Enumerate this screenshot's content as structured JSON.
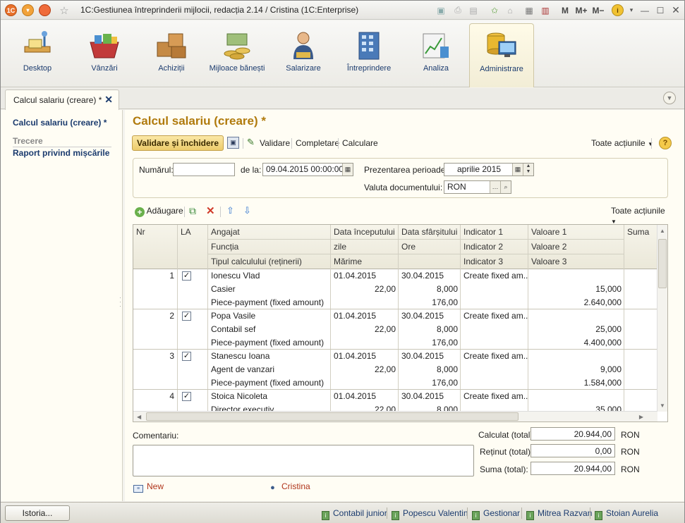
{
  "window": {
    "title": "1C:Gestiunea întreprinderii mijlocii, redacția 2.14 / Cristina  (1C:Enterprise)",
    "app_badge": "1C",
    "toolbar_right": [
      "M",
      "M+",
      "M−"
    ]
  },
  "sections": [
    {
      "label": "Desktop",
      "icon": "desk-icon"
    },
    {
      "label": "Vânzări",
      "icon": "basket-icon"
    },
    {
      "label": "Achiziții",
      "icon": "boxes-icon"
    },
    {
      "label": "Mijloace bănești",
      "icon": "coins-icon"
    },
    {
      "label": "Salarizare",
      "icon": "person-icon"
    },
    {
      "label": "Întreprindere",
      "icon": "building-icon"
    },
    {
      "label": "Analiza",
      "icon": "chart-icon"
    },
    {
      "label": "Administrare",
      "icon": "database-icon",
      "active": true
    }
  ],
  "tab": {
    "label": "Calcul salariu (creare) *"
  },
  "left_pane": {
    "current": "Calcul salariu (creare) *",
    "group": "Trecere",
    "link": "Raport privind mișcările"
  },
  "doc": {
    "title": "Calcul salariu (creare) *",
    "commands": {
      "validate_close": "Validare și închidere",
      "validate": "Validare",
      "fill": "Completare",
      "calculate": "Calculare",
      "all_actions": "Toate acțiunile"
    },
    "header": {
      "number_label": "Numărul:",
      "number_value": "",
      "date_label": "de la:",
      "date_value": "09.04.2015 00:00:00",
      "period_label": "Prezentarea perioadei:",
      "period_value": "aprilie 2015",
      "currency_label": "Valuta documentului:",
      "currency_value": "RON"
    },
    "table_bar": {
      "add": "Adăugare",
      "all_actions": "Toate acțiunile"
    },
    "columns": {
      "nr": "Nr",
      "la": "LA",
      "employee": "Angajat",
      "position": "Funcția",
      "calc_type": "Tipul calculului (reținerii)",
      "start": "Data începutului",
      "days": "zile",
      "size": "Mărime",
      "end": "Data sfârșitului",
      "hours": "Ore",
      "ind1": "Indicator 1",
      "ind2": "Indicator 2",
      "ind3": "Indicator 3",
      "val1": "Valoare 1",
      "val2": "Valoare 2",
      "val3": "Valoare 3",
      "sum": "Suma"
    },
    "rows": [
      {
        "nr": "1",
        "la": "✓",
        "employee": "Ionescu Vlad",
        "start": "01.04.2015",
        "end": "30.04.2015",
        "ind1": "Create fixed am...",
        "position": "Casier",
        "days": "22,00",
        "hours": "8,000",
        "val2": "15,000",
        "calc_type": "Piece-payment (fixed amount)",
        "size": "176,00",
        "val3": "2.640,000"
      },
      {
        "nr": "2",
        "la": "✓",
        "employee": "Popa Vasile",
        "start": "01.04.2015",
        "end": "30.04.2015",
        "ind1": "Create fixed am...",
        "position": "Contabil sef",
        "days": "22,00",
        "hours": "8,000",
        "val2": "25,000",
        "calc_type": "Piece-payment (fixed amount)",
        "size": "176,00",
        "val3": "4.400,000"
      },
      {
        "nr": "3",
        "la": "✓",
        "employee": "Stanescu Ioana",
        "start": "01.04.2015",
        "end": "30.04.2015",
        "ind1": "Create fixed am...",
        "position": "Agent de vanzari",
        "days": "22,00",
        "hours": "8,000",
        "val2": "9,000",
        "calc_type": "Piece-payment (fixed amount)",
        "size": "176,00",
        "val3": "1.584,000"
      },
      {
        "nr": "4",
        "la": "✓",
        "employee": "Stoica Nicoleta",
        "start": "01.04.2015",
        "end": "30.04.2015",
        "ind1": "Create fixed am...",
        "position": "Director executiv",
        "days": "22,00",
        "hours": "8,000",
        "val2": "35,000",
        "calc_type": "",
        "size": "",
        "val3": ""
      }
    ],
    "comment_label": "Comentariu:",
    "comment_value": "",
    "totals": {
      "calc_label": "Calculat (total):",
      "calc_value": "20.944,00",
      "ret_label": "Reținut (total):",
      "ret_value": "0,00",
      "sum_label": "Suma (total):",
      "sum_value": "20.944,00",
      "currency": "RON"
    },
    "footer": {
      "status": "New",
      "author": "Cristina"
    }
  },
  "statusbar": {
    "history": "Istoria...",
    "users": [
      "Contabil junior",
      "Popescu Valentin",
      "Gestionar",
      "Mitrea Razvan",
      "Stoian Aurelia"
    ]
  }
}
